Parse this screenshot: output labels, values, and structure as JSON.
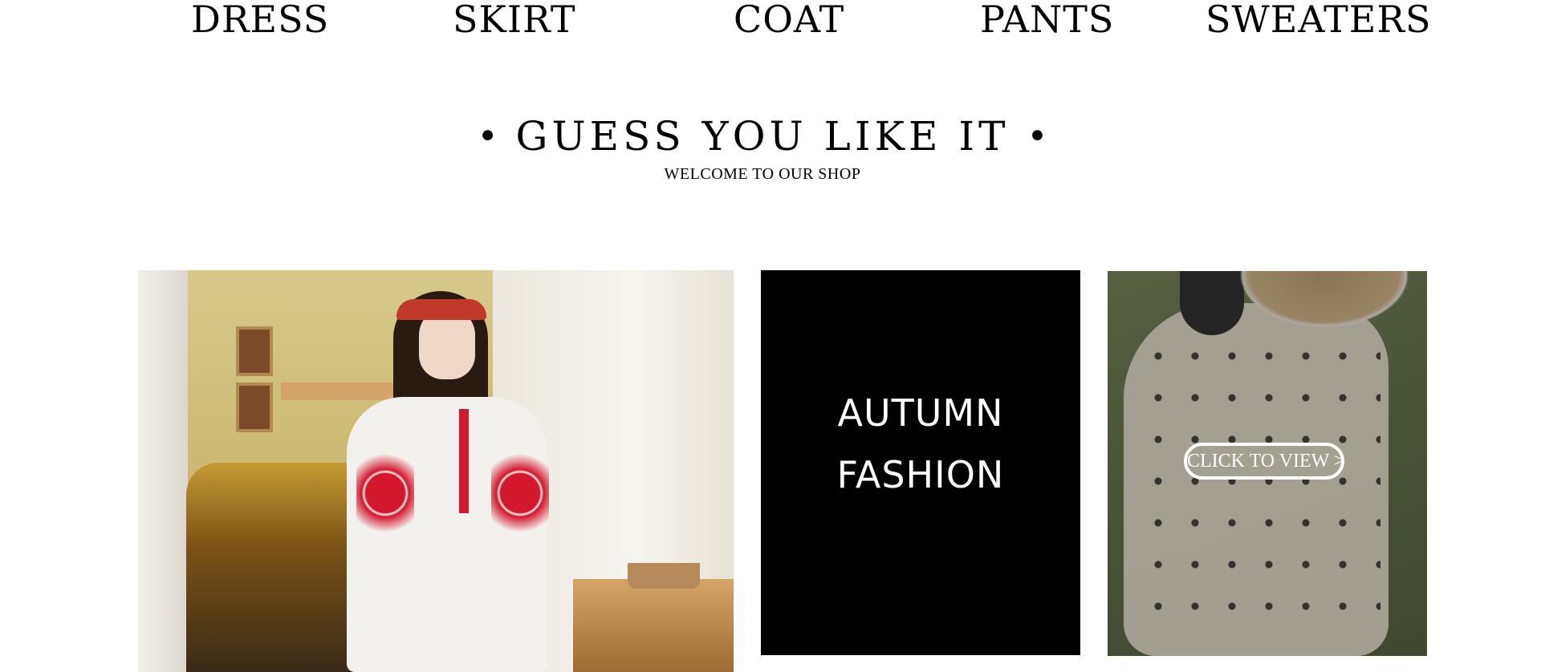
{
  "nav": {
    "items": [
      "DRESS",
      "SKIRT",
      "COAT",
      "PANTS",
      "SWEATERS"
    ]
  },
  "section": {
    "title": "GUESS YOU LIKE IT",
    "bullet": "•",
    "subtitle": "WELCOME TO OUR SHOP"
  },
  "tiles": {
    "promo_line1": "AUTUMN",
    "promo_line2": "FASHION",
    "cta_label": "CLICK TO VIEW >"
  }
}
